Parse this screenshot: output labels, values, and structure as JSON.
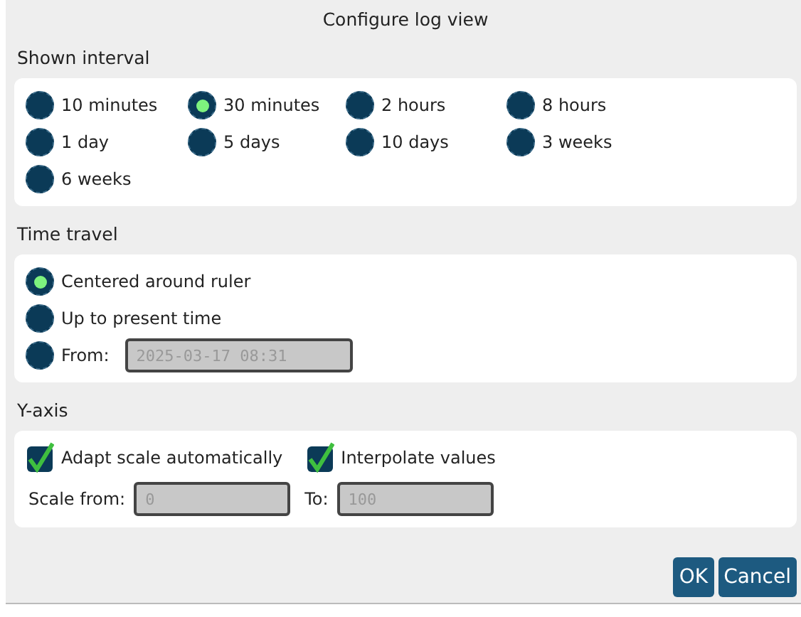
{
  "dialog": {
    "title": "Configure log view"
  },
  "shown_interval": {
    "label": "Shown interval",
    "options": [
      {
        "label": "10 minutes",
        "selected": false
      },
      {
        "label": "30 minutes",
        "selected": true
      },
      {
        "label": "2 hours",
        "selected": false
      },
      {
        "label": "8 hours",
        "selected": false
      },
      {
        "label": "1 day",
        "selected": false
      },
      {
        "label": "5 days",
        "selected": false
      },
      {
        "label": "10 days",
        "selected": false
      },
      {
        "label": "3 weeks",
        "selected": false
      },
      {
        "label": "6 weeks",
        "selected": false
      }
    ]
  },
  "time_travel": {
    "label": "Time travel",
    "options": [
      {
        "label": "Centered around ruler",
        "selected": true
      },
      {
        "label": "Up to present time",
        "selected": false
      },
      {
        "label": "From:",
        "selected": false,
        "field": {
          "value": "2025-03-17 08:31",
          "disabled": true
        }
      }
    ]
  },
  "y_axis": {
    "label": "Y-axis",
    "checkboxes": [
      {
        "label": "Adapt scale automatically",
        "checked": true
      },
      {
        "label": "Interpolate values",
        "checked": true
      }
    ],
    "scale_from": {
      "label": "Scale from:",
      "value": "0",
      "disabled": true
    },
    "scale_to": {
      "label": "To:",
      "value": "100",
      "disabled": true
    }
  },
  "buttons": [
    "OK",
    "Cancel"
  ]
}
